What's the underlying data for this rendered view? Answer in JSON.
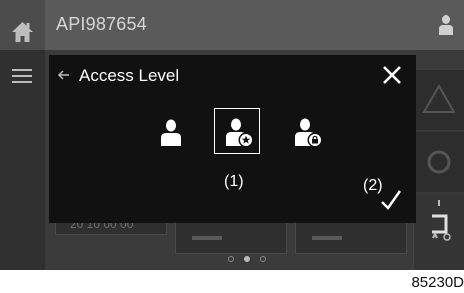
{
  "header": {
    "title": "API987654"
  },
  "dialog": {
    "title": "Access Level",
    "callout_1": "(1)",
    "callout_2": "(2)"
  },
  "background": {
    "faded_text": "20 10 00 00"
  },
  "pager": {
    "pages": 3,
    "active": 2
  },
  "figure_id": "85230D",
  "colors": {
    "topbar": "#5a5a5a",
    "dialog_bg": "#111111",
    "screen_bg": "#3b3b3b",
    "icon": "#ffffff"
  }
}
